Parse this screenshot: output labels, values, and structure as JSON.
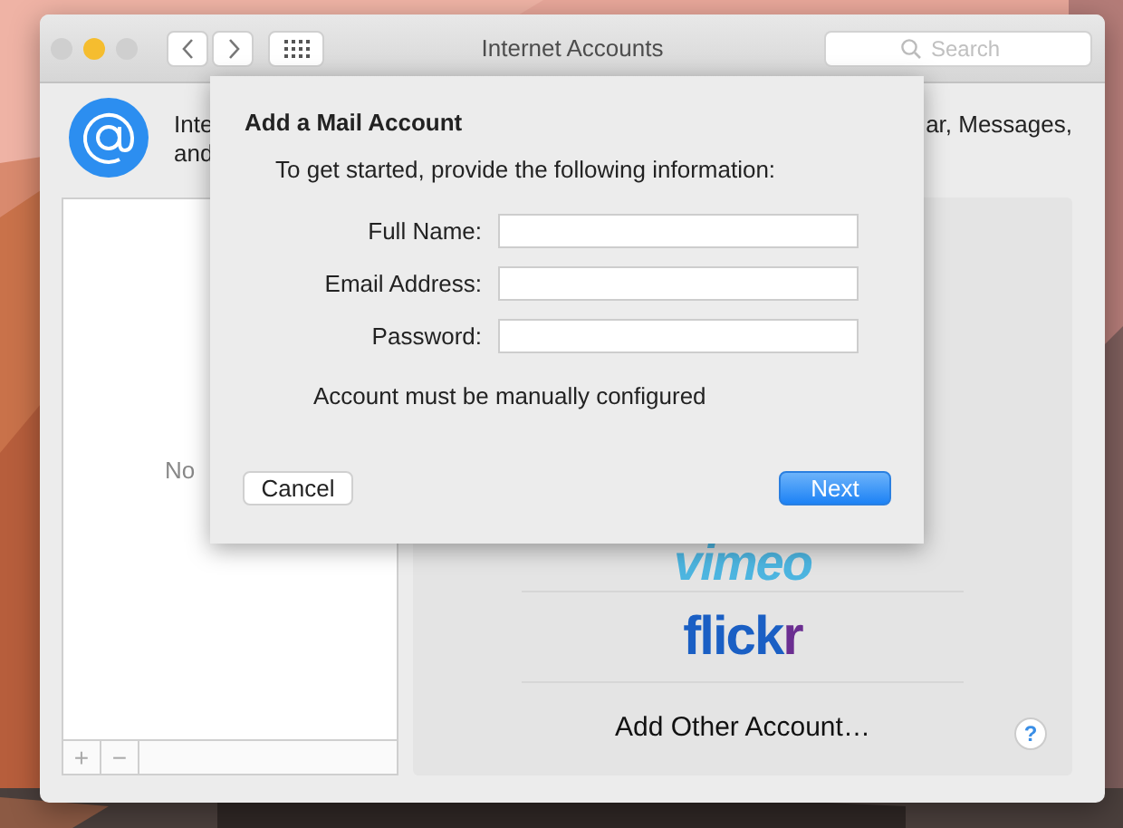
{
  "window": {
    "title": "Internet Accounts",
    "traffic_lights": [
      {
        "color": "#cfcfcf"
      },
      {
        "color": "#f5bd2f"
      },
      {
        "color": "#cfcfcf"
      }
    ],
    "search": {
      "placeholder": "Search"
    }
  },
  "description": {
    "left_lines": [
      "Inte",
      "and"
    ],
    "right_line": "ar, Messages,"
  },
  "accounts_list": {
    "empty_text": "No",
    "buttons": [
      "+",
      "−"
    ]
  },
  "providers": [
    {
      "kind": "vimeo",
      "label": "vimeo"
    },
    {
      "kind": "flickr",
      "label": "flickr"
    },
    {
      "kind": "text",
      "label": "Add Other Account…"
    }
  ],
  "help": "?",
  "dialog": {
    "title": "Add a Mail Account",
    "intro": "To get started, provide the following information:",
    "fields": [
      {
        "label": "Full Name:"
      },
      {
        "label": "Email Address:"
      },
      {
        "label": "Password:"
      }
    ],
    "status": "Account must be manually configured",
    "buttons": [
      {
        "label": "Cancel",
        "kind": "secondary"
      },
      {
        "label": "Next",
        "kind": "primary"
      }
    ]
  }
}
